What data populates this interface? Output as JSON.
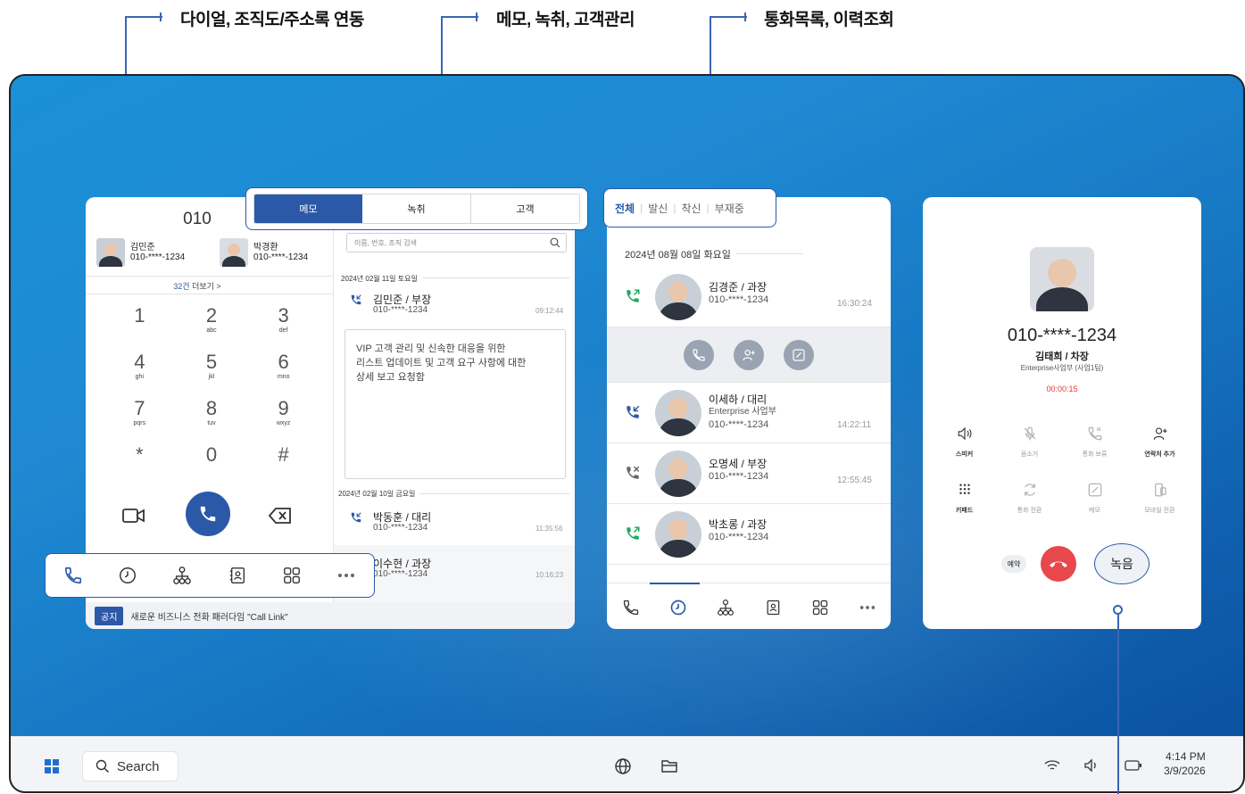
{
  "callouts": {
    "dial": "다이얼, 조직도/주소록 연동",
    "memo": "메모, 녹취, 고객관리",
    "history": "통화목록, 이력조회"
  },
  "dialer": {
    "number": "010",
    "favorites": [
      {
        "name": "김민준",
        "phone": "010-****-1234"
      },
      {
        "name": "박경환",
        "phone": "010-****-1234"
      }
    ],
    "more_count": "32건",
    "more_label": "더보기 >",
    "keys": [
      {
        "d": "1",
        "s": ""
      },
      {
        "d": "2",
        "s": "abc"
      },
      {
        "d": "3",
        "s": "def"
      },
      {
        "d": "4",
        "s": "ghi"
      },
      {
        "d": "5",
        "s": "jkl"
      },
      {
        "d": "6",
        "s": "mno"
      },
      {
        "d": "7",
        "s": "pqrs"
      },
      {
        "d": "8",
        "s": "tuv"
      },
      {
        "d": "9",
        "s": "wxyz"
      },
      {
        "d": "*",
        "s": ""
      },
      {
        "d": "0",
        "s": ""
      },
      {
        "d": "#",
        "s": ""
      }
    ],
    "notice_badge": "공지",
    "notice_text": "새로운 비즈니스 전화 패러다임 \"Call Link\""
  },
  "memo": {
    "tabs": [
      "메모",
      "녹취",
      "고객"
    ],
    "search_placeholder": "이름, 번호, 조직 검색",
    "groups": [
      {
        "date": "2024년 02월 11일 토요일",
        "calls": [
          {
            "name": "김민준 / 부장",
            "phone": "010-****-1234",
            "time": "09:12:44"
          }
        ]
      },
      {
        "date": "2024년 02월 10일 금요일",
        "calls": [
          {
            "name": "박동훈 / 대리",
            "phone": "010-****-1234",
            "time": "11:35:56"
          },
          {
            "name": "이수현 / 과장",
            "phone": "010-****-1234",
            "time": "10:16:23"
          }
        ]
      }
    ],
    "note": "VIP 고객 관리 및 신속한 대응을 위한\n리스트 업데이트 및 고객 요구 사항에 대한\n상세 보고 요청함"
  },
  "history": {
    "filters": [
      "전체",
      "발신",
      "착신",
      "부재중"
    ],
    "date": "2024년 08월 08일 화요일",
    "calls": [
      {
        "name": "김경준 / 과장",
        "sub": "",
        "phone": "010-****-1234",
        "time": "16:30:24",
        "type": "outgoing"
      },
      {
        "name": "이세하 / 대리",
        "sub": "Enterprise 사업부",
        "phone": "010-****-1234",
        "time": "14:22:11",
        "type": "incoming"
      },
      {
        "name": "오명세 / 부장",
        "sub": "",
        "phone": "010-****-1234",
        "time": "12:55:45",
        "type": "missed"
      },
      {
        "name": "박초롱 / 과장",
        "sub": "",
        "phone": "010-****-1234",
        "time": "",
        "type": "outgoing"
      }
    ]
  },
  "incall": {
    "number": "010-****-1234",
    "name": "김태희 / 차장",
    "dept": "Enterprise사업부 (사업1팀)",
    "timer": "00:00:15",
    "controls": [
      "스피커",
      "음소거",
      "통화 보류",
      "연락처 추가",
      "키패드",
      "통화 전환",
      "메모",
      "모바일 전환"
    ],
    "reserve": "예약",
    "record": "녹음"
  },
  "taskbar": {
    "search": "Search",
    "time": "4:14 PM",
    "date": "3/9/2026"
  },
  "colors": {
    "accent": "#2b59a8",
    "green": "#1eaa62",
    "red": "#e8474c",
    "timer": "#e53935"
  }
}
